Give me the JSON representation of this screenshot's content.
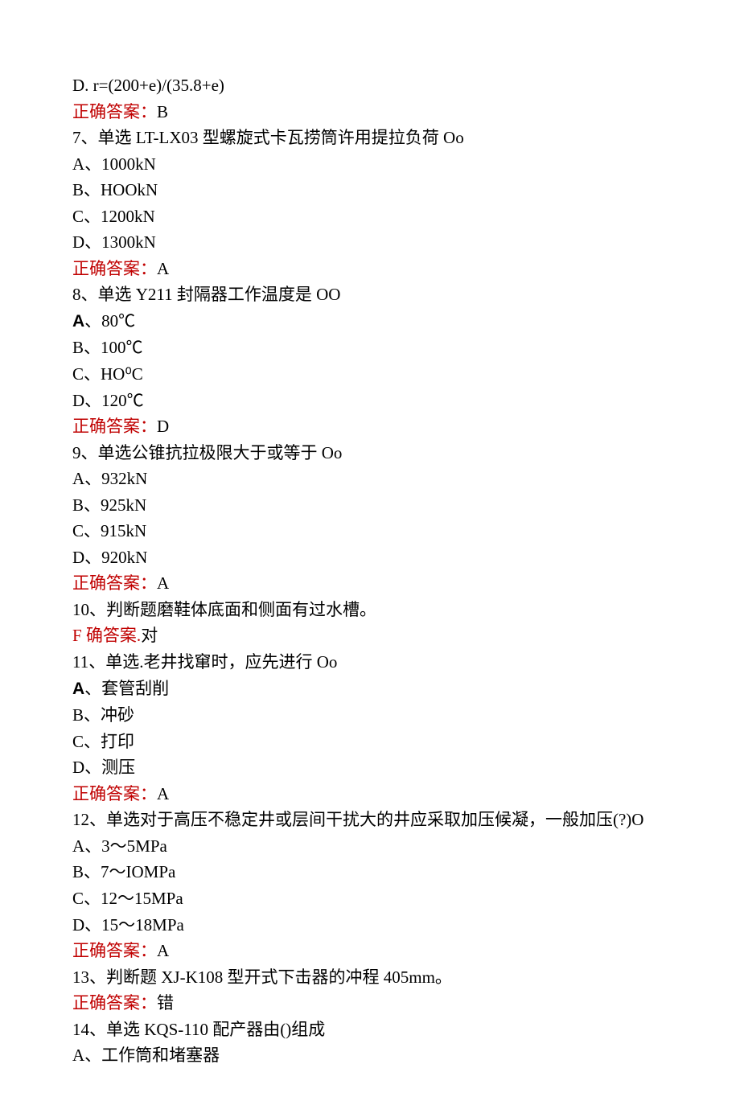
{
  "q6": {
    "optD": "D. r=(200+e)/(35.8+e)",
    "ansLabel": "正确答案：",
    "ans": "B"
  },
  "q7": {
    "stem": "7、单选 LT-LX03 型螺旋式卡瓦捞筒许用提拉负荷 Oo",
    "A": "A、1000kN",
    "B": "B、HOOkN",
    "C": "C、1200kN",
    "D": "D、1300kN",
    "ansLabel": "正确答案：",
    "ans": "A"
  },
  "q8": {
    "stem": "8、单选 Y211 封隔器工作温度是 OO",
    "A_prefix": "A",
    "A_rest": "、80℃",
    "B": "B、100℃",
    "C": "C、HO⁰C",
    "D": "D、120℃",
    "ansLabel": "正确答案：",
    "ans": "D"
  },
  "q9": {
    "stem": "9、单选公锥抗拉极限大于或等于 Oo",
    "A": "A、932kN",
    "B": "B、925kN",
    "C": "C、915kN",
    "D": "D、920kN",
    "ansLabel": "正确答案：",
    "ans": "A"
  },
  "q10": {
    "stem": "10、判断题磨鞋体底面和侧面有过水槽。",
    "ansLabel": "F 确答案.",
    "ans": "对"
  },
  "q11": {
    "stem": "11、单选.老井找窜时，应先进行 Oo",
    "A_prefix": "A",
    "A_rest": "、套管刮削",
    "B": "B、冲砂",
    "C": "C、打印",
    "D": "D、测压",
    "ansLabel": "正确答案：",
    "ans": "A"
  },
  "q12": {
    "stem": "12、单选对于高压不稳定井或层间干扰大的井应采取加压候凝，一般加压(?)O",
    "A": "A、3～5MPa",
    "B": "B、7～IOMPa",
    "C": "C、12～15MPa",
    "D": "D、15～18MPa",
    "ansLabel": "正确答案：",
    "ans": "A"
  },
  "q13": {
    "stem": "13、判断题 XJ-K108 型开式下击器的冲程 405mm。",
    "ansLabel": "正确答案：",
    "ans": "错"
  },
  "q14": {
    "stem": "14、单选 KQS-110 配产器由()组成",
    "A": "A、工作筒和堵塞器"
  }
}
